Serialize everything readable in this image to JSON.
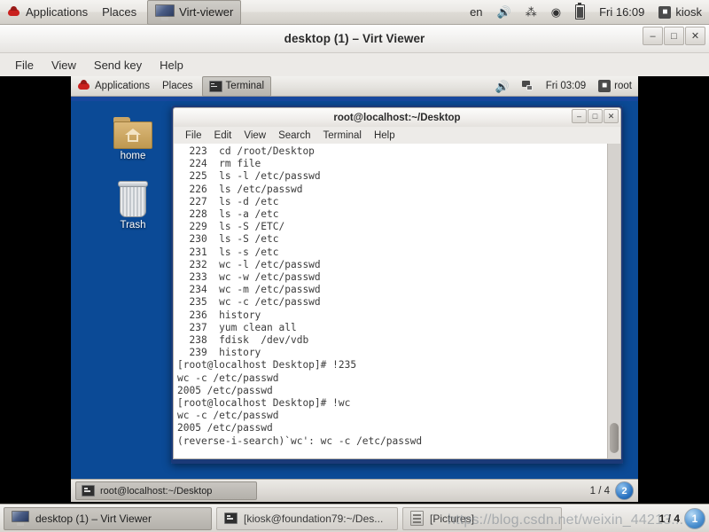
{
  "host_panel": {
    "menus": [
      "Applications",
      "Places"
    ],
    "active_task": "Virt-viewer",
    "keyboard_layout": "en",
    "clock": "Fri 16:09",
    "user": "kiosk",
    "icons": {
      "redhat": "redhat-logo-icon",
      "volume": "volume-icon",
      "bluetooth": "bluetooth-icon",
      "wifi": "wifi-icon",
      "battery": "battery-icon",
      "user": "user-icon"
    }
  },
  "virt_viewer": {
    "title": "desktop (1) – Virt Viewer",
    "menus": [
      "File",
      "View",
      "Send key",
      "Help"
    ],
    "window_buttons": {
      "minimize": "–",
      "maximize": "□",
      "close": "✕"
    }
  },
  "guest_panel": {
    "menus": [
      "Applications",
      "Places"
    ],
    "active_task": "Terminal",
    "clock": "Fri 03:09",
    "user": "root"
  },
  "desktop_icons": [
    {
      "label": "home",
      "icon": "home-folder-icon"
    },
    {
      "label": "Trash",
      "icon": "trash-icon"
    }
  ],
  "terminal": {
    "title": "root@localhost:~/Desktop",
    "menus": [
      "File",
      "Edit",
      "View",
      "Search",
      "Terminal",
      "Help"
    ],
    "window_buttons": {
      "minimize": "–",
      "maximize": "□",
      "close": "✕"
    },
    "lines": [
      "  223  cd /root/Desktop",
      "  224  rm file",
      "  225  ls -l /etc/passwd",
      "  226  ls /etc/passwd",
      "  227  ls -d /etc",
      "  228  ls -a /etc",
      "  229  ls -S /ETC/",
      "  230  ls -S /etc",
      "  231  ls -s /etc",
      "  232  wc -l /etc/passwd",
      "  233  wc -w /etc/passwd",
      "  234  wc -m /etc/passwd",
      "  235  wc -c /etc/passwd",
      "  236  history",
      "  237  yum clean all",
      "  238  fdisk  /dev/vdb",
      "  239  history",
      "[root@localhost Desktop]# !235",
      "wc -c /etc/passwd",
      "2005 /etc/passwd",
      "[root@localhost Desktop]# !wc",
      "wc -c /etc/passwd",
      "2005 /etc/passwd",
      "(reverse-i-search)`wc': wc -c /etc/passwd"
    ]
  },
  "guest_taskbar": {
    "task": "root@localhost:~/Desktop",
    "pager": "1 / 4",
    "workspace_badge": "2"
  },
  "host_taskbar": {
    "tasks": [
      {
        "label": "desktop (1) – Virt Viewer",
        "icon": "virt-viewer-icon",
        "active": true
      },
      {
        "label": "[kiosk@foundation79:~/Des...",
        "icon": "terminal-icon",
        "active": false
      },
      {
        "label": "[Pictures]",
        "icon": "file-manager-icon",
        "active": false
      }
    ],
    "pager": "1 / 4",
    "workspace_badge": "1"
  },
  "watermark": "https://blog.csdn.net/weixin_44213...",
  "colors": {
    "desktop_blue": "#0b4a96",
    "title_blue": "#1b3a78",
    "panel_grey": "#e7e5e1",
    "accent_blue": "#17489e"
  }
}
